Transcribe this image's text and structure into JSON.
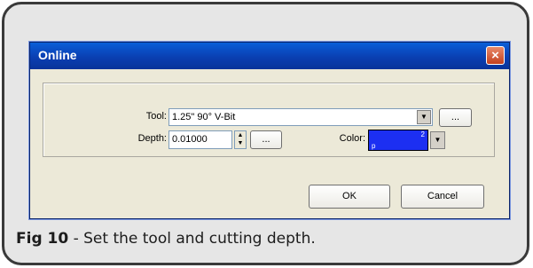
{
  "dialog": {
    "title": "Online",
    "close_glyph": "×",
    "tool_label": "Tool:",
    "tool_value": "1.25\" 90° V-Bit",
    "tool_browse_label": "...",
    "depth_label": "Depth:",
    "depth_value": "0.01000",
    "depth_browse_label": "...",
    "color_label": "Color:",
    "color_index": "2",
    "color_hex": "#1c2ff2",
    "ok_label": "OK",
    "cancel_label": "Cancel"
  },
  "caption": {
    "figure": "Fig 10",
    "text": " - Set the tool and cutting depth."
  }
}
